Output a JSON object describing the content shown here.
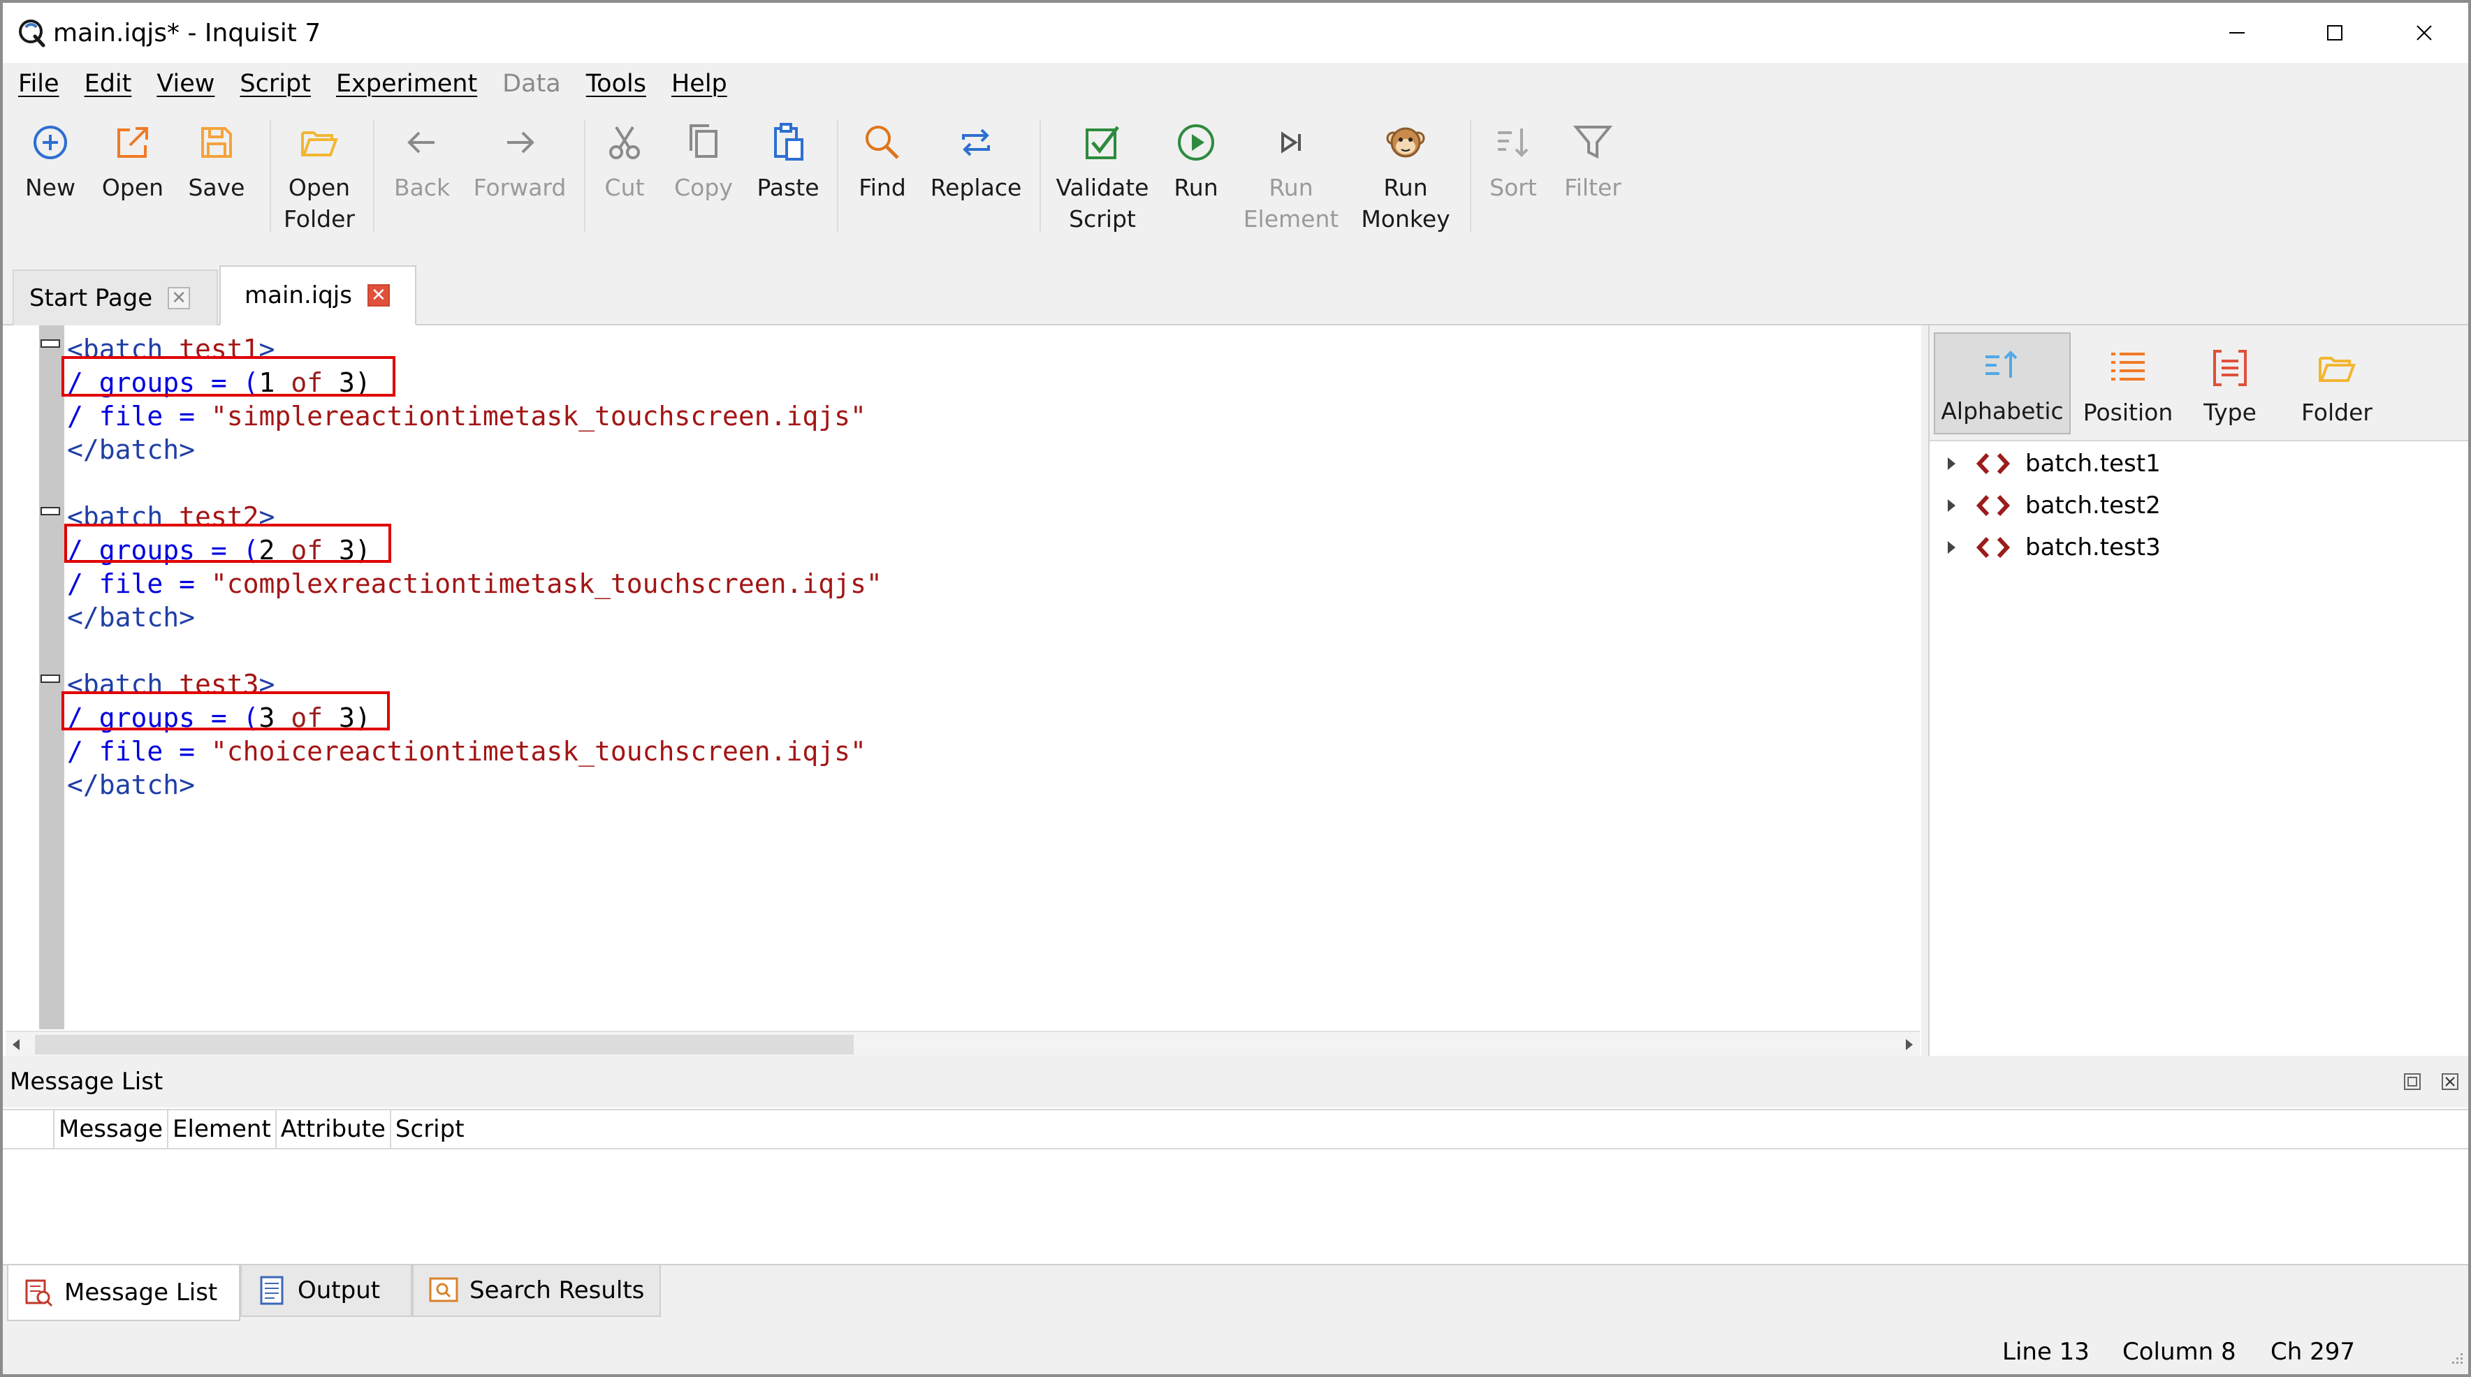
{
  "window": {
    "title": "main.iqjs* - Inquisit 7",
    "minimize_glyph": "—",
    "maximize_glyph": "☐",
    "close_glyph": "✕"
  },
  "menu": [
    "File",
    "Edit",
    "View",
    "Script",
    "Experiment",
    "Data",
    "Tools",
    "Help"
  ],
  "toolbar": {
    "new": "New",
    "open": "Open",
    "save": "Save",
    "open_folder_1": "Open",
    "open_folder_2": "Folder",
    "back": "Back",
    "forward": "Forward",
    "cut": "Cut",
    "copy": "Copy",
    "paste": "Paste",
    "find": "Find",
    "replace": "Replace",
    "validate_1": "Validate",
    "validate_2": "Script",
    "run": "Run",
    "run_element_1": "Run",
    "run_element_2": "Element",
    "run_monkey_1": "Run",
    "run_monkey_2": "Monkey",
    "sort": "Sort",
    "filter": "Filter"
  },
  "tabs": [
    {
      "label": "Start Page",
      "close": "✕"
    },
    {
      "label": "main.iqjs",
      "close": "✕"
    }
  ],
  "code": {
    "open1": "<batch ",
    "name1": "test1",
    "close_br": ">",
    "groups_pre": "/ groups = (",
    "of": "of",
    "three": " 3)",
    "g1": "1 ",
    "g2": "2 ",
    "g3": "3 ",
    "file_pre": "/ file = ",
    "file1": "\"simplereactiontimetask_touchscreen.iqjs\"",
    "file2": "\"complexreactiontimetask_touchscreen.iqjs\"",
    "file3": "\"choicereactiontimetask_touchscreen.iqjs\"",
    "end": "</batch>",
    "open2": "<batch ",
    "name2": "test2",
    "open3": "<batch ",
    "name3": "test3"
  },
  "sort_buttons": [
    "Alphabetic",
    "Position",
    "Type",
    "Folder"
  ],
  "tree": [
    "batch.test1",
    "batch.test2",
    "batch.test3"
  ],
  "message_list": {
    "title": "Message List",
    "columns": [
      "Message",
      "Element",
      "Attribute",
      "Script"
    ]
  },
  "bottom_tabs": [
    "Message List",
    "Output",
    "Search Results"
  ],
  "status": {
    "line": "Line  13",
    "column": "Column  8",
    "ch": "Ch  297"
  },
  "colors": {
    "highlight": "#e00000",
    "tag": "#1f3ea6",
    "element_name": "#a31515",
    "attribute": "#0000e0"
  }
}
